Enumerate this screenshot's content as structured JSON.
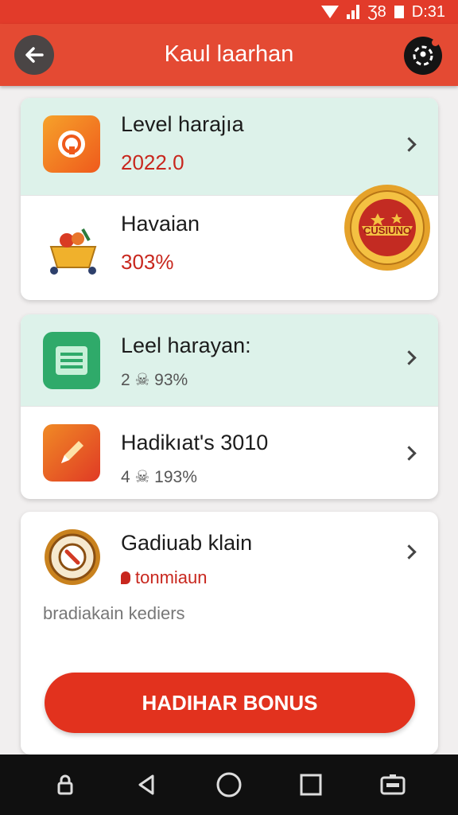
{
  "status_bar": {
    "indicators": "Ʒ8",
    "time": "D:31"
  },
  "app_bar": {
    "title": "Kaul laarhan",
    "back_icon": "back-arrow-icon",
    "profile_icon": "profile-icon"
  },
  "card1": {
    "row1": {
      "title": "Level harajıa",
      "value": "2022.0"
    },
    "row2": {
      "title": "Havaian",
      "value": "303%"
    },
    "seal_text": "CUSIUNO"
  },
  "card2": {
    "row1": {
      "title": "Leel harayan:",
      "sub": "2 ☠ 93%"
    },
    "row2": {
      "title": "Hadikıat's 3010",
      "sub": "4 ☠ 193%"
    }
  },
  "card3": {
    "title": "Gadiuab klain",
    "tag": "tonmiaun",
    "note": "bradiakain kediers",
    "button": "HADIHAR BONUS"
  },
  "colors": {
    "primary": "#e44a33",
    "value_red": "#c8271e",
    "mint": "#ddf2ea"
  }
}
